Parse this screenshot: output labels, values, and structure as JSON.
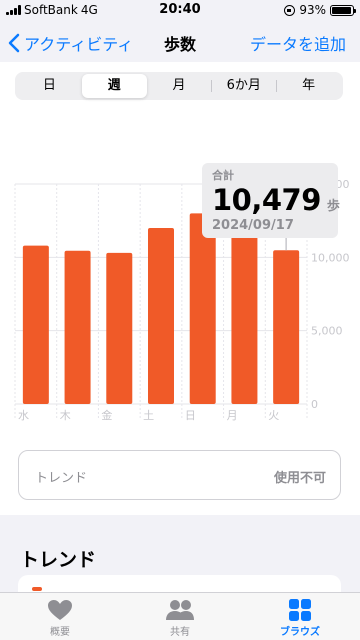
{
  "status_bar": {
    "carrier": "SoftBank",
    "network": "4G",
    "time": "20:40",
    "battery_percent": "93%",
    "battery_level": 0.93
  },
  "nav": {
    "back_label": "アクティビティ",
    "title": "歩数",
    "add_label": "データを追加"
  },
  "segments": [
    {
      "label": "日",
      "active": false
    },
    {
      "label": "週",
      "active": true
    },
    {
      "label": "月",
      "active": false
    },
    {
      "label": "6か月",
      "active": false
    },
    {
      "label": "年",
      "active": false
    }
  ],
  "selection": {
    "label": "合計",
    "value": "10,479",
    "unit": "歩",
    "date": "2024/09/17"
  },
  "chart_data": {
    "type": "bar",
    "categories": [
      "水",
      "木",
      "金",
      "土",
      "日",
      "月",
      "火"
    ],
    "values": [
      10800,
      10450,
      10300,
      12000,
      13000,
      13200,
      10479
    ],
    "ylim": [
      0,
      15000
    ],
    "yticks": [
      "0",
      "5,000",
      "10,000",
      "15,000"
    ],
    "ytick_values": [
      0,
      5000,
      10000,
      15000
    ],
    "highlight_index": 6,
    "bar_color": "#f05a28",
    "grid": true
  },
  "trend_card": {
    "label": "トレンド",
    "status": "使用不可"
  },
  "section_title": "トレンド",
  "tabs": [
    {
      "label": "概要",
      "icon": "heart-icon",
      "active": false
    },
    {
      "label": "共有",
      "icon": "people-icon",
      "active": false
    },
    {
      "label": "ブラウズ",
      "icon": "grid-icon",
      "active": true
    }
  ],
  "colors": {
    "accent": "#0a7aff",
    "bar": "#f05a28",
    "secondary_text": "#8e8e93"
  }
}
